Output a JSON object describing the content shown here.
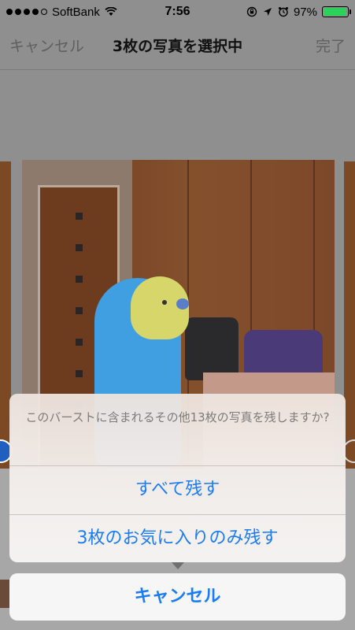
{
  "status_bar": {
    "carrier": "SoftBank",
    "time": "7:56",
    "battery_percent": "97%",
    "battery_level": 0.97,
    "signal_dots_filled": 4,
    "icons": [
      "signal-dots-icon",
      "wifi-icon",
      "rotation-lock-icon",
      "location-arrow-icon",
      "alarm-icon",
      "battery-icon"
    ]
  },
  "nav": {
    "cancel_label": "キャンセル",
    "title": "3枚の写真を選択中",
    "done_label": "完了"
  },
  "action_sheet": {
    "message": "このバーストに含まれるその他13枚の写真を残しますか?",
    "keep_all_label": "すべて残す",
    "keep_favorites_label": "3枚のお気に入りのみ残す",
    "cancel_label": "キャンセル"
  },
  "colors": {
    "accent": "#1a7df7",
    "battery": "#2bd15a",
    "selected_circle": "#1f5fbf"
  }
}
